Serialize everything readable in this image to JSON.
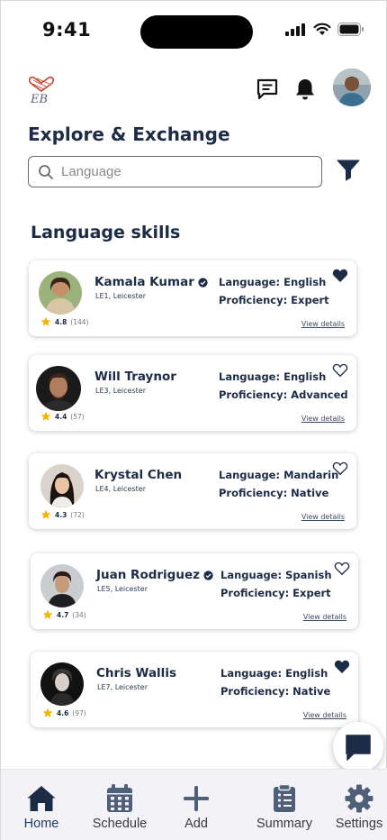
{
  "status_bar": {
    "time": "9:41"
  },
  "header": {
    "logo_text": "EB"
  },
  "page": {
    "title": "Explore & Exchange",
    "search_placeholder": "Language",
    "section_title": "Language skills"
  },
  "cards": [
    {
      "name": "Kamala Kumar",
      "verified": true,
      "location": "LE1, Leicester",
      "rating": "4.8",
      "reviews": "(144)",
      "language": "Language: English",
      "proficiency": "Proficiency: Expert",
      "favorited": true,
      "details": "View details"
    },
    {
      "name": "Will Traynor",
      "verified": false,
      "location": "LE3, Leicester",
      "rating": "4.4",
      "reviews": "(57)",
      "language": "Language: English",
      "proficiency": "Proficiency: Advanced",
      "favorited": false,
      "details": "View details"
    },
    {
      "name": "Krystal Chen",
      "verified": false,
      "location": "LE4, Leicester",
      "rating": "4.3",
      "reviews": "(72)",
      "language": "Language: Mandarin",
      "proficiency": "Proficiency: Native",
      "favorited": false,
      "details": "View details"
    },
    {
      "name": "Juan Rodriguez",
      "verified": true,
      "location": "LE5, Leicester",
      "rating": "4.7",
      "reviews": "(34)",
      "language": "Language: Spanish",
      "proficiency": "Proficiency: Expert",
      "favorited": false,
      "details": "View details"
    },
    {
      "name": "Chris Wallis",
      "verified": false,
      "location": "LE7, Leicester",
      "rating": "4.6",
      "reviews": "(97)",
      "language": "Language: English",
      "proficiency": "Proficiency: Native",
      "favorited": true,
      "details": "View details"
    }
  ],
  "nav": [
    {
      "label": "Home",
      "icon": "home-icon",
      "active": true
    },
    {
      "label": "Schedule",
      "icon": "calendar-icon",
      "active": false
    },
    {
      "label": "Add",
      "icon": "plus-icon",
      "active": false
    },
    {
      "label": "Summary",
      "icon": "clipboard-icon",
      "active": false
    },
    {
      "label": "Settings",
      "icon": "gear-icon",
      "active": false
    }
  ],
  "colors": {
    "navy": "#1c2b46",
    "nav_icon": "#4f5f78",
    "star": "#f5b400"
  }
}
